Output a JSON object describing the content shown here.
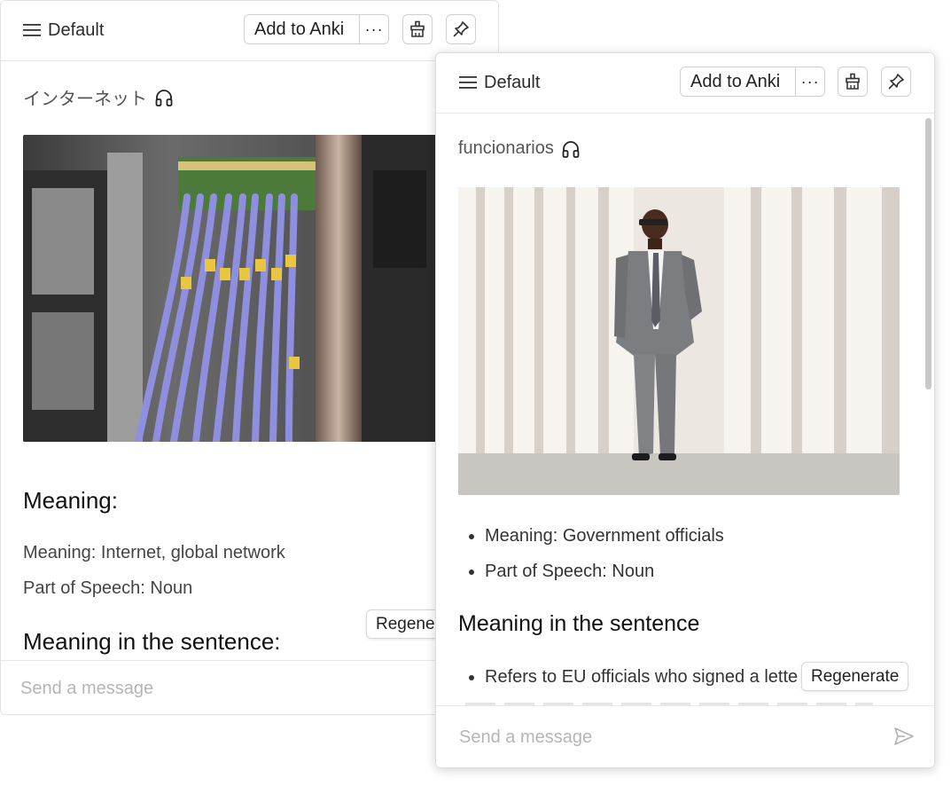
{
  "back_panel": {
    "profile_label": "Default",
    "add_to_anki_label": "Add to Anki",
    "more_label": "···",
    "word": "インターネット",
    "meaning_heading": "Meaning:",
    "meaning_line": "Meaning: Internet, global network",
    "pos_line": "Part of Speech: Noun",
    "sentence_heading": "Meaning in the sentence:",
    "regenerate_label": "Regene",
    "composer_placeholder": "Send a message"
  },
  "front_panel": {
    "profile_label": "Default",
    "add_to_anki_label": "Add to Anki",
    "more_label": "···",
    "word": "funcionarios",
    "bullets": [
      "Meaning: Government officials",
      "Part of Speech: Noun"
    ],
    "sentence_heading": "Meaning in the sentence",
    "sentence_bullet": "Refers to EU officials who signed a lette",
    "regenerate_label": "Regenerate",
    "composer_placeholder": "Send a message"
  },
  "icons": {
    "menu": "hamburger-icon",
    "clean": "broom-icon",
    "pin": "pin-icon",
    "audio": "headphones-icon",
    "send": "send-icon"
  },
  "colors": {
    "border": "#cfcfcf",
    "placeholder": "#b5b5b5",
    "text": "#1f1f1f"
  }
}
